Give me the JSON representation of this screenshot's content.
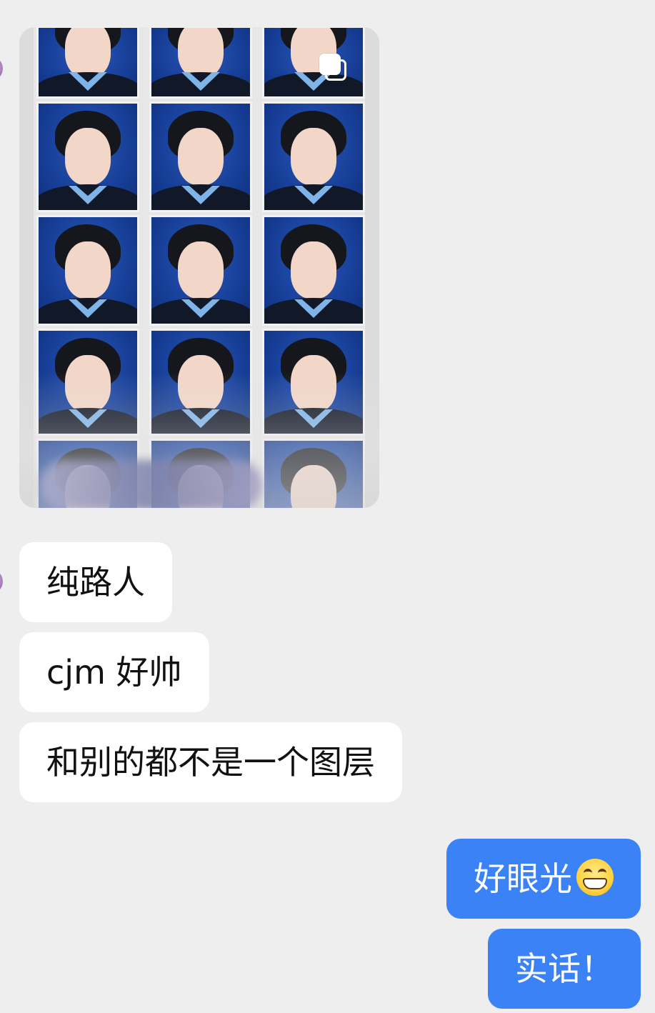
{
  "chat": {
    "incoming": [
      {
        "text": "纯路人"
      },
      {
        "text": "cjm 好帅"
      },
      {
        "text": "和别的都不是一个图层"
      }
    ],
    "outgoing": [
      {
        "text": "好眼光",
        "emoji": "grinning-face-emoji"
      },
      {
        "text": "实话！"
      }
    ],
    "image_message": {
      "icon": "multi-image-icon",
      "blurred_watermark": true
    }
  },
  "colors": {
    "background": "#eeeeee",
    "incoming_bubble": "#ffffff",
    "outgoing_bubble": "#3b82f6",
    "portrait_background": "#173f98"
  }
}
